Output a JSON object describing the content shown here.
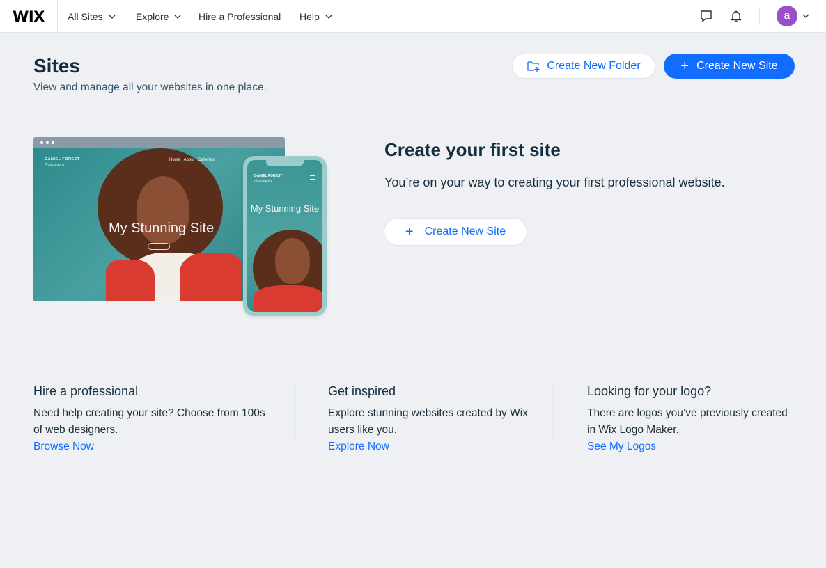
{
  "topbar": {
    "logo": "WIX",
    "nav": [
      {
        "label": "All Sites"
      },
      {
        "label": "Explore"
      },
      {
        "label": "Hire a Professional"
      },
      {
        "label": "Help"
      }
    ],
    "avatar_initial": "a"
  },
  "header": {
    "title": "Sites",
    "subtitle": "View and manage all your websites in one place.",
    "create_folder_label": "Create New Folder",
    "create_site_label": "Create New Site",
    "create_site_plus": "+"
  },
  "illustration": {
    "brand": "DANIEL FOREST",
    "brand_sub": "Photography",
    "nav_items": "Home   |   About   |   Galleries",
    "site_title": "My Stunning Site",
    "phone_brand": "DANIEL FOREST",
    "phone_brand_sub": "Photography",
    "phone_title": "My Stunning Site"
  },
  "empty_state": {
    "title": "Create your first site",
    "text": "You’re on your way to creating your first professional website.",
    "button_label": "Create New Site",
    "button_plus": "+"
  },
  "footer": {
    "columns": [
      {
        "title": "Hire a professional",
        "text": "Need help creating your site? Choose from 100s of web designers.",
        "link": "Browse Now"
      },
      {
        "title": "Get inspired",
        "text": "Explore stunning websites created by Wix users like you.",
        "link": "Explore Now"
      },
      {
        "title": "Looking for your logo?",
        "text": "There are logos you’ve previously created in Wix Logo Maker.",
        "link": "See My Logos"
      }
    ]
  },
  "colors": {
    "accent": "#116dff",
    "page_bg": "#eef0f4",
    "avatar_bg": "#9a4fc6",
    "text_primary": "#162d3d"
  }
}
